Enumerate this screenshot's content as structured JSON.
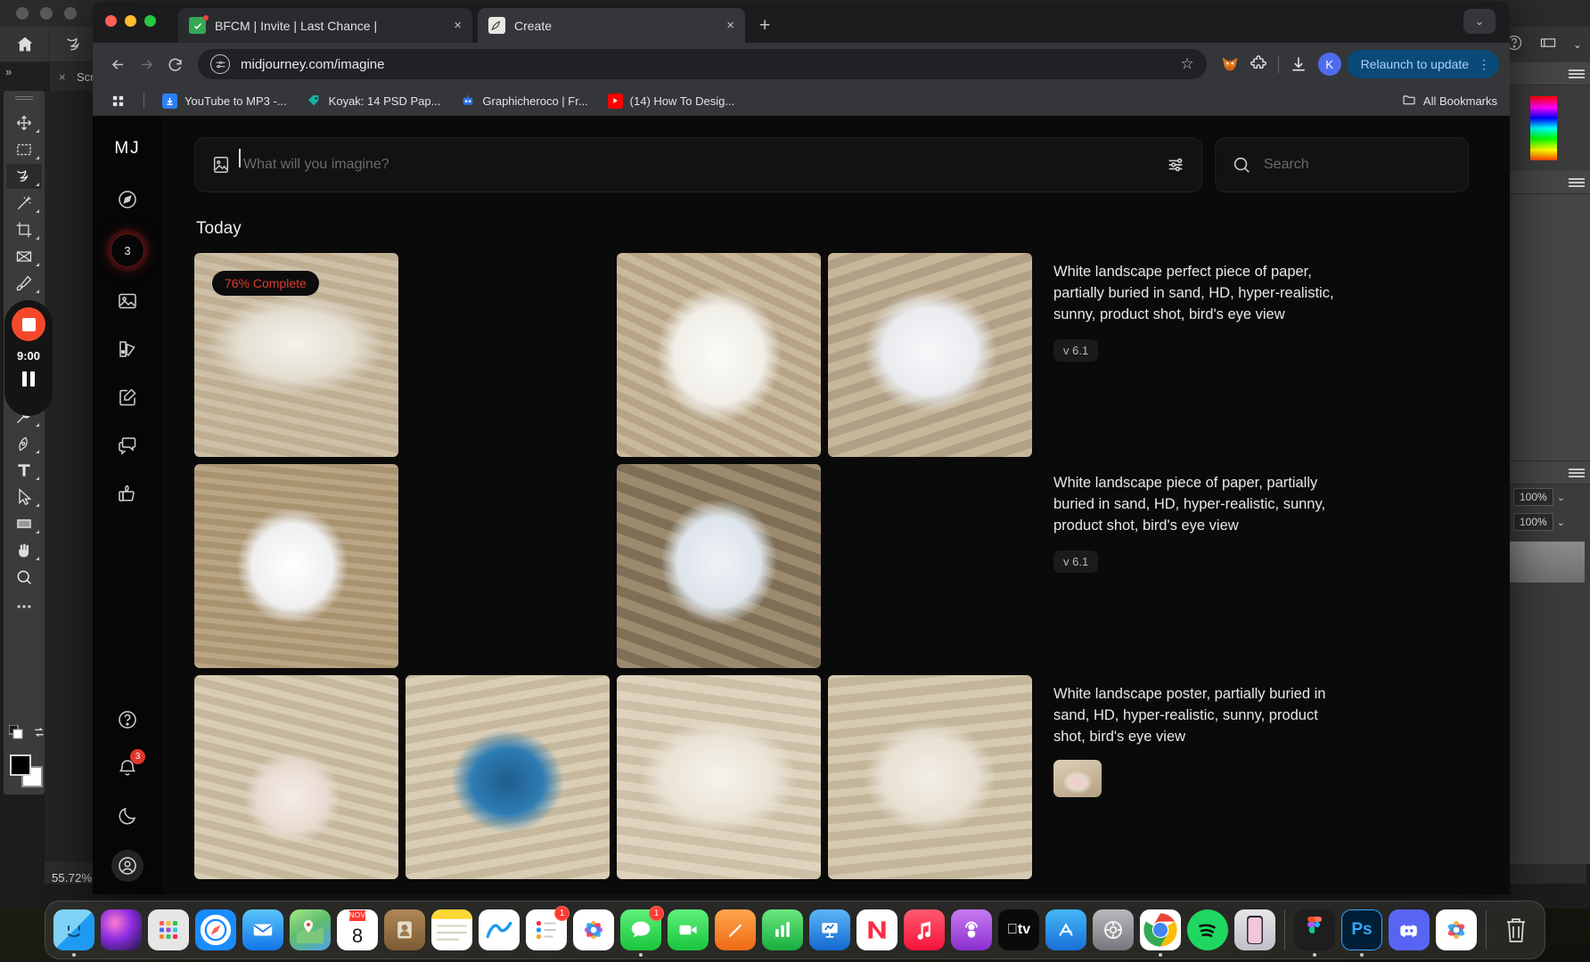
{
  "photoshop": {
    "tab_title": "Scr",
    "zoom_level": "55.72%",
    "opacity_value": "100%",
    "fill_value": "100%",
    "opacity_label": ":",
    "fill_label": "l:",
    "tools": [
      {
        "name": "move-tool"
      },
      {
        "name": "marquee-tool"
      },
      {
        "name": "lasso-tool"
      },
      {
        "name": "magic-wand-tool"
      },
      {
        "name": "crop-tool"
      },
      {
        "name": "frame-tool"
      },
      {
        "name": "eyedropper-tool"
      },
      {
        "name": "healing-brush-tool"
      },
      {
        "name": "paint-bucket-tool"
      },
      {
        "name": "blur-tool"
      },
      {
        "name": "brush-tool"
      },
      {
        "name": "dodge-tool"
      },
      {
        "name": "pen-tool"
      },
      {
        "name": "type-tool"
      },
      {
        "name": "path-selection-tool"
      },
      {
        "name": "rectangle-tool"
      },
      {
        "name": "hand-tool"
      },
      {
        "name": "zoom-tool"
      },
      {
        "name": "more-tools"
      }
    ]
  },
  "recorder": {
    "time": "9:00",
    "stop_label": "stop-recording",
    "pause_label": "pause-recording"
  },
  "browser": {
    "tabs": [
      {
        "title": "BFCM | Invite | Last Chance |",
        "favicon": "checklist-icon",
        "active": false
      },
      {
        "title": "Create",
        "favicon": "midjourney-icon",
        "active": true
      }
    ],
    "new_tab_label": "+",
    "window_chevron": "⌄",
    "nav": {
      "back": "back-arrow",
      "forward": "forward-arrow",
      "reload": "reload-icon"
    },
    "url": "midjourney.com/imagine",
    "star_label": "☆",
    "extensions": [
      "metamask-icon",
      "extensions-puzzle-icon"
    ],
    "download_label": "download-icon",
    "avatar_letter": "K",
    "relaunch_label": "Relaunch to update",
    "kebab_label": "⋮",
    "bookmarks": [
      {
        "label": "YouTube to MP3 -...",
        "icon": "download-blue-icon",
        "color": "#2d7ff9"
      },
      {
        "label": "Koyak: 14 PSD Pap...",
        "icon": "tag-teal-icon",
        "color": "#17b3a3"
      },
      {
        "label": "Graphicheroco | Fr...",
        "icon": "robot-blue-icon",
        "color": "#2f6fe0"
      },
      {
        "label": "(14) How To Desig...",
        "icon": "youtube-icon",
        "color": "#ff0000"
      }
    ],
    "all_bookmarks_label": "All Bookmarks"
  },
  "midjourney": {
    "logo": "MJ",
    "rail": [
      {
        "name": "explore-icon",
        "label": "Explore"
      },
      {
        "name": "jobs-badge",
        "label": "3"
      },
      {
        "name": "gallery-icon",
        "label": "Gallery"
      },
      {
        "name": "organize-icon",
        "label": "Organize"
      },
      {
        "name": "edit-icon",
        "label": "Edit"
      },
      {
        "name": "chat-icon",
        "label": "Chat"
      },
      {
        "name": "rate-icon",
        "label": "Rate"
      }
    ],
    "rail_bottom": [
      {
        "name": "help-icon",
        "label": "Help"
      },
      {
        "name": "bell-icon",
        "label": "Notifications",
        "badge": "3"
      },
      {
        "name": "moon-icon",
        "label": "Dark mode"
      },
      {
        "name": "account-icon",
        "label": "Account"
      }
    ],
    "prompt_placeholder": "What will you imagine?",
    "prompt_image_icon": "image-upload-icon",
    "prompt_settings_icon": "sliders-icon",
    "search_placeholder": "Search",
    "search_icon": "search-icon",
    "day_label": "Today",
    "groups": [
      {
        "prompt": "White landscape perfect piece of paper, partially buried in sand, HD, hyper-realistic, sunny, product shot, bird's eye view",
        "version": "v 6.1",
        "progress_badge": "76% Complete",
        "tiles": [
          "sandA",
          "sandB",
          "sandC",
          "sandD"
        ]
      },
      {
        "prompt": "White landscape piece of paper, partially buried in sand, HD, hyper-realistic, sunny, product shot, bird's eye view",
        "version": "v 6.1",
        "progress_badge": null,
        "tiles": [
          "sandE",
          "sandF",
          "sandG",
          "sandH"
        ]
      },
      {
        "prompt": "White landscape poster, partially buried in sand, HD, hyper-realistic, sunny, product shot, bird's eye view",
        "version": null,
        "progress_badge": null,
        "tiles": [
          "sandI",
          "sandJ",
          "sandK",
          "sandL"
        ]
      }
    ]
  },
  "dock": {
    "apps": [
      {
        "name": "finder",
        "glyph": "",
        "bg": "#1e9bf0",
        "running": true
      },
      {
        "name": "siri",
        "glyph": "",
        "bg": "#2a2a3a",
        "running": false
      },
      {
        "name": "launchpad",
        "glyph": "",
        "bg": "#d8d8d8",
        "running": false
      },
      {
        "name": "safari",
        "glyph": "",
        "bg": "#1a8cff",
        "running": false
      },
      {
        "name": "mail",
        "glyph": "✉",
        "bg": "#1e9bf0",
        "running": false
      },
      {
        "name": "maps",
        "glyph": "",
        "bg": "#6ec06e",
        "running": false
      },
      {
        "name": "calendar",
        "glyph": "",
        "bg": "#ffffff",
        "running": false,
        "month": "NOV",
        "day": "8"
      },
      {
        "name": "contacts",
        "glyph": "",
        "bg": "#9c7a4f",
        "running": false
      },
      {
        "name": "notes",
        "glyph": "",
        "bg": "#fdd835",
        "running": false
      },
      {
        "name": "freeform",
        "glyph": "",
        "bg": "#ffffff",
        "running": false
      },
      {
        "name": "reminders",
        "glyph": "",
        "bg": "#ffffff",
        "running": false,
        "badge": "1"
      },
      {
        "name": "photos",
        "glyph": "",
        "bg": "#ffffff",
        "running": false
      },
      {
        "name": "messages",
        "glyph": "",
        "bg": "#35d24b",
        "running": true,
        "badge": "1"
      },
      {
        "name": "facetime",
        "glyph": "",
        "bg": "#35d24b",
        "running": false
      },
      {
        "name": "pages",
        "glyph": "",
        "bg": "#f5822a",
        "running": false
      },
      {
        "name": "numbers",
        "glyph": "",
        "bg": "#35c759",
        "running": false
      },
      {
        "name": "keynote",
        "glyph": "",
        "bg": "#1e88e5",
        "running": false
      },
      {
        "name": "news",
        "glyph": "N",
        "bg": "#ffffff",
        "running": false
      },
      {
        "name": "music",
        "glyph": "♪",
        "bg": "#fa2d48",
        "running": false
      },
      {
        "name": "podcasts",
        "glyph": "",
        "bg": "#9b4dd8",
        "running": false
      },
      {
        "name": "appletv",
        "glyph": "tv",
        "bg": "#0a0a0a",
        "running": false
      },
      {
        "name": "appstore",
        "glyph": "A",
        "bg": "#1e88e5",
        "running": false
      },
      {
        "name": "settings",
        "glyph": "",
        "bg": "#8e8e93",
        "running": false
      },
      {
        "name": "chrome",
        "glyph": "",
        "bg": "#ffffff",
        "running": true
      },
      {
        "name": "spotify",
        "glyph": "",
        "bg": "#1ed760",
        "running": false
      },
      {
        "name": "iphone-mirroring",
        "glyph": "",
        "bg": "#d8d8da",
        "running": false
      }
    ],
    "apps_right": [
      {
        "name": "figma",
        "glyph": "",
        "bg": "#1e1e1e",
        "running": true
      },
      {
        "name": "photoshop",
        "glyph": "Ps",
        "bg": "#001e36",
        "running": true
      },
      {
        "name": "discord",
        "glyph": "",
        "bg": "#5865f2",
        "running": false
      },
      {
        "name": "photos-alt",
        "glyph": "",
        "bg": "#ffffff",
        "running": false
      }
    ],
    "trash": {
      "name": "trash",
      "glyph": ""
    }
  }
}
